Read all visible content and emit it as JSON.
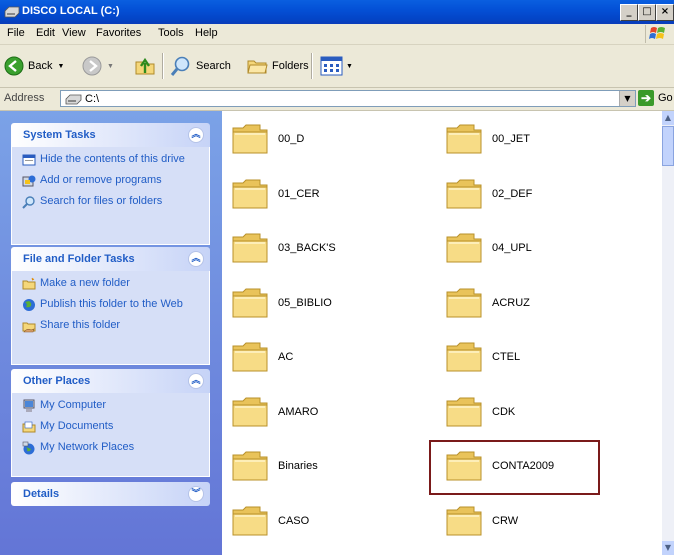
{
  "window": {
    "title": "DISCO LOCAL (C:)",
    "minimize": "_",
    "restore": "□",
    "close": "×"
  },
  "menu": {
    "items": [
      "File",
      "Edit",
      "View",
      "Favorites",
      "Tools",
      "Help"
    ]
  },
  "toolbar": {
    "back_label": "Back",
    "search_label": "Search",
    "folders_label": "Folders"
  },
  "address": {
    "label": "Address",
    "value": "C:\\",
    "go_label": "Go"
  },
  "system_tasks": {
    "title": "System Tasks",
    "items": [
      "Hide the contents of this drive",
      "Add or remove programs",
      "Search for files or folders"
    ]
  },
  "file_tasks": {
    "title": "File and Folder Tasks",
    "items": [
      "Make a new folder",
      "Publish this folder to the Web",
      "Share this folder"
    ]
  },
  "other_places": {
    "title": "Other Places",
    "items": [
      "My Computer",
      "My Documents",
      "My Network Places"
    ]
  },
  "details": {
    "title": "Details"
  },
  "folders": [
    "00_D",
    "00_JET",
    "01_CER",
    "02_DEF",
    "03_BACK'S",
    "04_UPL",
    "05_BIBLIO",
    "ACRUZ",
    "AC",
    "CTEL",
    "AMARO",
    "CDK",
    "Binaries",
    "CONTA2009",
    "CASO",
    "CRW"
  ],
  "colors": {
    "title_bar": "#0450d6",
    "task_link": "#215dc6",
    "highlight_border": "#7a1a1a",
    "folder": "#f5d77a"
  }
}
